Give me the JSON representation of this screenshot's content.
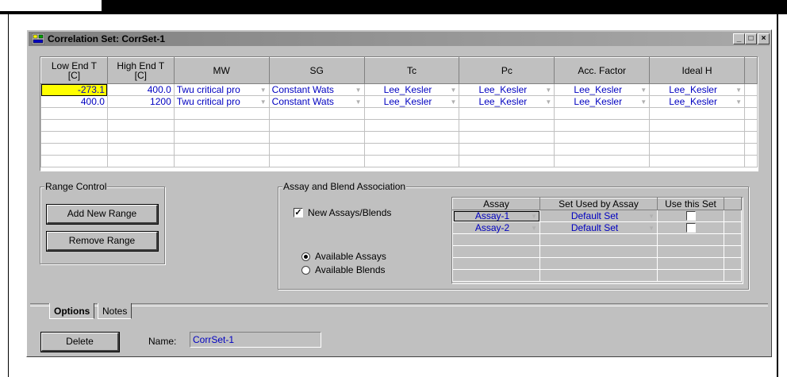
{
  "window": {
    "title": "Correlation Set: CorrSet-1",
    "controls": {
      "minimize": "_",
      "maximize": "□",
      "close": "×"
    }
  },
  "grid": {
    "columns": [
      {
        "label": "Low End T\n[C]"
      },
      {
        "label": "High End T\n[C]"
      },
      {
        "label": "MW"
      },
      {
        "label": "SG"
      },
      {
        "label": "Tc"
      },
      {
        "label": "Pc"
      },
      {
        "label": "Acc. Factor"
      },
      {
        "label": "Ideal H"
      }
    ],
    "rows": [
      {
        "low": "-273.1",
        "high": "400.0",
        "mw": "Twu critical pro",
        "sg": "Constant Wats",
        "tc": "Lee_Kesler",
        "pc": "Lee_Kesler",
        "acc": "Lee_Kesler",
        "idealh": "Lee_Kesler"
      },
      {
        "low": "400.0",
        "high": "1200",
        "mw": "Twu critical pro",
        "sg": "Constant Wats",
        "tc": "Lee_Kesler",
        "pc": "Lee_Kesler",
        "acc": "Lee_Kesler",
        "idealh": "Lee_Kesler"
      }
    ]
  },
  "range_control": {
    "title": "Range Control",
    "add_label": "Add New Range",
    "remove_label": "Remove Range"
  },
  "assay_group": {
    "title": "Assay and Blend Association",
    "new_checkbox_label": "New Assays/Blends",
    "new_checkbox_checked": true,
    "radio_assays": "Available Assays",
    "radio_blends": "Available Blends",
    "table_headers": [
      "Assay",
      "Set Used by Assay",
      "Use this Set"
    ],
    "table_rows": [
      {
        "assay": "Assay-1",
        "set": "Default Set",
        "use": false
      },
      {
        "assay": "Assay-2",
        "set": "Default Set",
        "use": false
      }
    ]
  },
  "tabs": [
    {
      "label": "Options",
      "active": true
    },
    {
      "label": "Notes",
      "active": false
    }
  ],
  "footer": {
    "delete_label": "Delete",
    "name_label": "Name:",
    "name_value": "CorrSet-1"
  },
  "colors": {
    "face": "#c0c0c0",
    "link_text": "#0000c0",
    "selected_cell": "#ffff00"
  }
}
